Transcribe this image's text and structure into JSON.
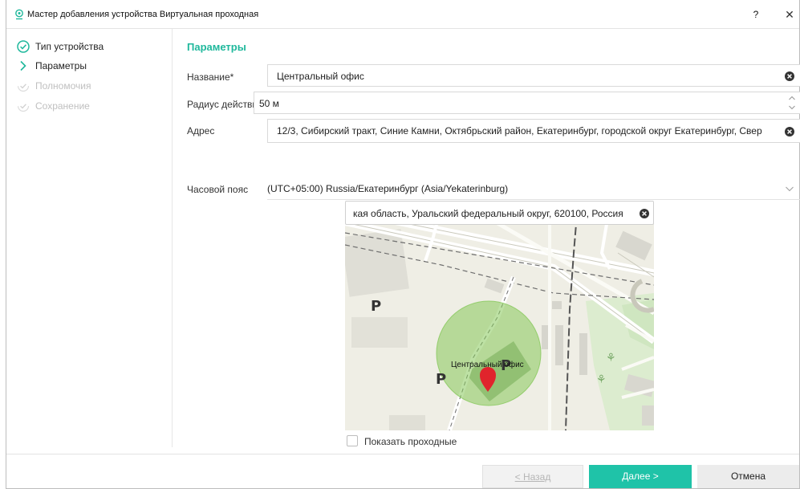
{
  "window": {
    "title": "Мастер добавления устройства Виртуальная проходная",
    "help_label": "?",
    "close_label": "✕"
  },
  "steps": [
    {
      "label": "Тип устройства",
      "state": "done"
    },
    {
      "label": "Параметры",
      "state": "current"
    },
    {
      "label": "Полномочия",
      "state": "pending"
    },
    {
      "label": "Сохранение",
      "state": "pending"
    }
  ],
  "section": {
    "title": "Параметры"
  },
  "form": {
    "name": {
      "label": "Название*",
      "value": "Центральный офис"
    },
    "radius": {
      "label": "Радиус действия",
      "value": "50 м"
    },
    "address": {
      "label": "Адрес",
      "value": "12/3, Сибирский тракт, Синие Камни, Октябрьский район, Екатеринбург, городской округ Екатеринбург, Свер"
    },
    "timezone": {
      "label": "Часовой пояс",
      "value": "(UTC+05:00) Russia/Екатеринбург (Asia/Yekaterinburg)"
    }
  },
  "map": {
    "search_value": "кая область, Уральский федеральный округ, 620100, Россия",
    "marker_label": "Центральный офис",
    "parking_label": "P"
  },
  "show_checkpoints": {
    "label": "Показать проходные",
    "checked": false
  },
  "footer": {
    "back_label": "< Назад",
    "next_label": "Далее >",
    "cancel_label": "Отмена"
  },
  "colors": {
    "accent": "#1fc3a8",
    "section_title": "#1fb89c",
    "marker": "#e0242c",
    "radius_fill": "#86c85a"
  }
}
